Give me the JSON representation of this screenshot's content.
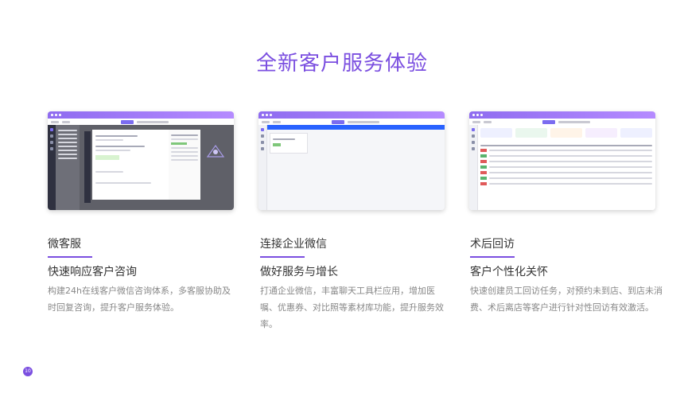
{
  "page": {
    "title": "全新客户服务体验",
    "page_number": "10",
    "accent_color": "#7b4fe0"
  },
  "features": [
    {
      "title": "微客服",
      "subtitle": "快速响应客户咨询",
      "description": "构建24h在线客户微信咨询体系，多客服协助及时回复咨询，提升客户服务体验。"
    },
    {
      "title": "连接企业微信",
      "subtitle": "做好服务与增长",
      "description": "打通企业微信，丰富聊天工具栏应用，增加医嘱、优惠券、对比照等素材库功能，提升服务效率。"
    },
    {
      "title": "术后回访",
      "subtitle": "客户个性化关怀",
      "description": "快速创建员工回访任务，对预约未到店、到店未消费、术后离店等客户进行针对性回访有效激活。"
    }
  ]
}
